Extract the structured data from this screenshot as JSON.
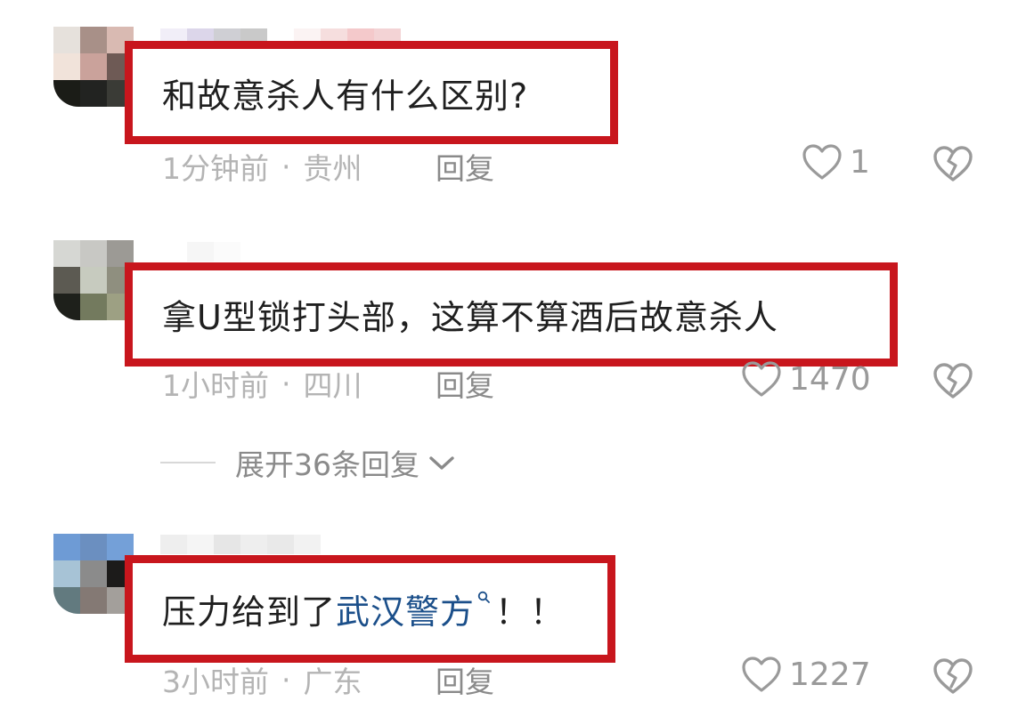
{
  "comments": [
    {
      "text": "和故意杀人有什么区别?",
      "time": "1分钟前",
      "location": "贵州",
      "reply_label": "回复",
      "likes": "1",
      "icons": {
        "like": "heart-outline-icon",
        "dislike": "broken-heart-icon"
      }
    },
    {
      "text": "拿U型锁打头部，这算不算酒后故意杀人",
      "time": "1小时前",
      "location": "四川",
      "reply_label": "回复",
      "likes": "1470",
      "expand_replies": "展开36条回复",
      "icons": {
        "like": "heart-outline-icon",
        "dislike": "broken-heart-icon",
        "expand": "chevron-down-icon"
      }
    },
    {
      "text_before": "压力给到了",
      "link_text": "武汉警方",
      "text_after": "！！",
      "time": "3小时前",
      "location": "广东",
      "reply_label": "回复",
      "likes": "1227",
      "icons": {
        "like": "heart-outline-icon",
        "dislike": "broken-heart-icon",
        "search": "search-icon"
      }
    }
  ],
  "separator": "·",
  "colors": {
    "highlight_border": "#c8161d",
    "link": "#1b4f8a",
    "meta_text": "#b4b4b4",
    "icon_gray": "#9a9a9a"
  }
}
